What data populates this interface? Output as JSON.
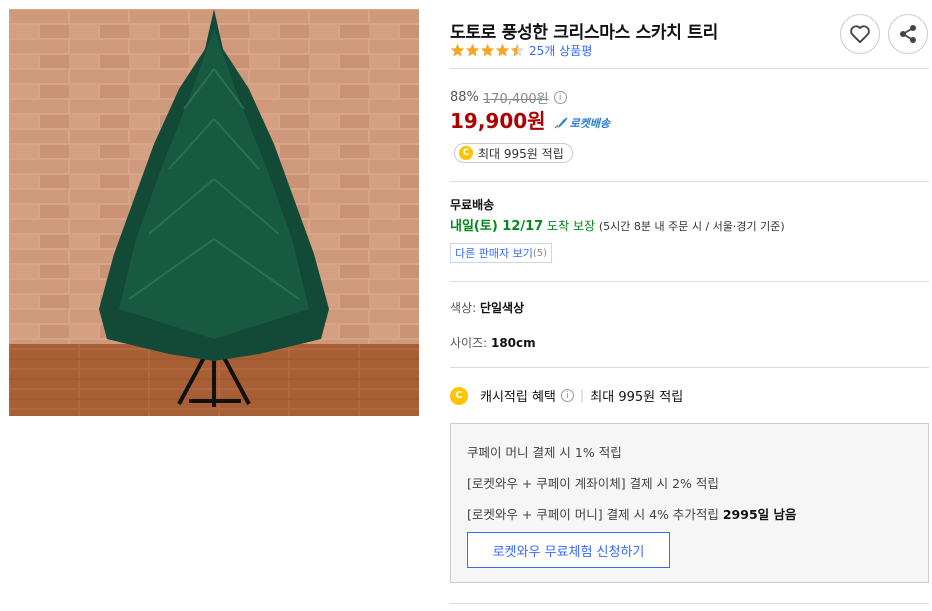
{
  "product": {
    "title": "도토로 풍성한 크리스마스 스카치 트리",
    "rating": 4.5,
    "review_count": "25개 상품평"
  },
  "price": {
    "discount_rate": "88%",
    "original": "170,400원",
    "info_mark": "i",
    "sale": "19,900원",
    "rocket_label": "로켓배송",
    "cash_pill_coin": "C",
    "cash_pill": "최대 995원 적립"
  },
  "shipping": {
    "title": "무료배송",
    "date": "내일(토) 12/17",
    "guarantee": "도착 보장",
    "note": "(5시간 8분  내 주문 시 / 서울·경기 기준)",
    "other_sellers": "다른 판매자 보기",
    "other_sellers_count": "(5)"
  },
  "options": {
    "color_label": "색상: ",
    "color_value": "단일색상",
    "size_label": "사이즈: ",
    "size_value": "180cm"
  },
  "cashback": {
    "coin": "C",
    "label": "캐시적립 혜택",
    "info_mark": "i",
    "separator": "|",
    "value": "최대 995원 적립"
  },
  "benefits": {
    "line1": "쿠페이 머니 결제 시 1% 적립",
    "line2": "[로켓와우 + 쿠페이 계좌이체] 결제 시 2% 적립",
    "line3_prefix": "[로켓와우 + 쿠페이 머니] 결제 시 4% 추가적립 ",
    "line3_bold": "2995일 남음",
    "trial_button": "로켓와우 무료체험 신청하기"
  },
  "colors": {
    "sale_price": "#ae0000",
    "link_blue": "#346aff",
    "delivery_green": "#00891a",
    "star": "#f5a623",
    "coin": "#ffc300"
  },
  "icons": [
    "heart-icon",
    "share-icon",
    "star-icon",
    "info-icon",
    "rocket-icon",
    "coin-icon"
  ]
}
